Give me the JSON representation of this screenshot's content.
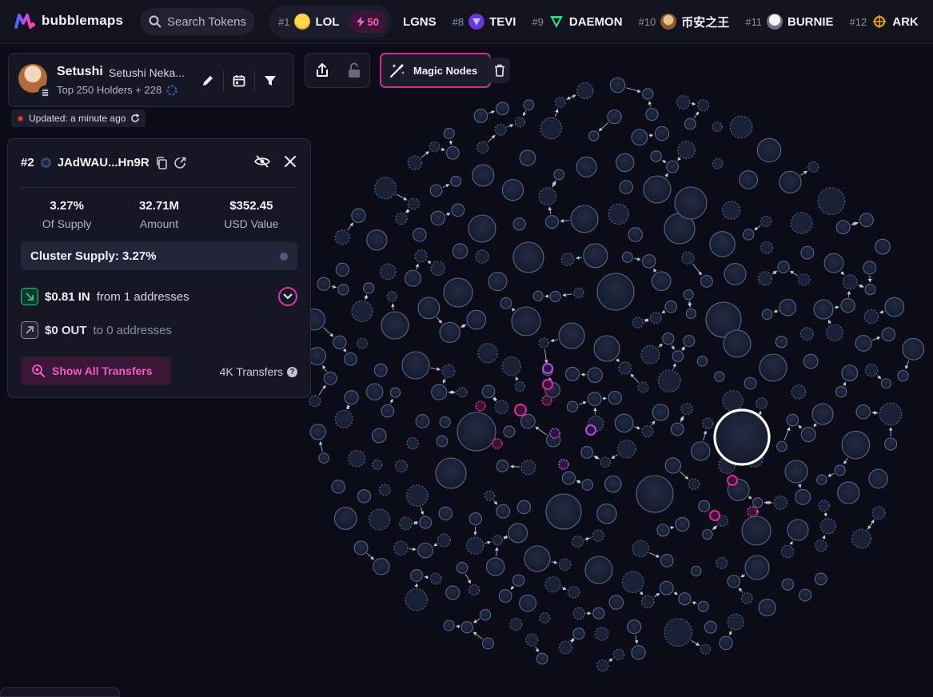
{
  "app": {
    "brand": "bubblemaps",
    "search_placeholder": "Search Tokens"
  },
  "ticker": {
    "first": {
      "rank": "#1",
      "name": "LOL",
      "boost": "50"
    },
    "items": [
      {
        "rank": "",
        "name": "LGNS",
        "icon_color": ""
      },
      {
        "rank": "#8",
        "name": "TEVI",
        "icon_color": "#7a3df0"
      },
      {
        "rank": "#9",
        "name": "DAEMON",
        "icon_color": "#35d07f"
      },
      {
        "rank": "#10",
        "name": "币安之王",
        "icon_color": "#b07a35"
      },
      {
        "rank": "#11",
        "name": "BURNIE",
        "icon_color": "#d9d9e0"
      },
      {
        "rank": "#12",
        "name": "ARK",
        "icon_color": "#e3a524"
      }
    ]
  },
  "wallet": {
    "name": "Setushi",
    "subtitle": "Setushi Neka...",
    "holders": "Top 250 Holders + 228",
    "updated": "Updated: a minute ago"
  },
  "toolbar": {
    "magic_label": "Magic Nodes"
  },
  "detail": {
    "rank": "#2",
    "address": "JAdWAU...Hn9R",
    "stats": [
      {
        "value": "3.27%",
        "label": "Of Supply"
      },
      {
        "value": "32.71M",
        "label": "Amount"
      },
      {
        "value": "$352.45",
        "label": "USD Value"
      }
    ],
    "cluster": "Cluster Supply: 3.27%",
    "in_amount": "$0.81 IN",
    "in_desc": "from 1 addresses",
    "out_amount": "$0 OUT",
    "out_desc": "to 0 addresses",
    "show_transfers": "Show All Transfers",
    "transfers_count": "4K Transfers"
  },
  "colors": {
    "accent": "#d0299f",
    "bubble_fill": "#1b2236",
    "bubble_stroke": "#5b668c",
    "highlight_pink": "#e0279b",
    "highlight_purple": "#b54ee6",
    "selected": "#ffffff"
  }
}
